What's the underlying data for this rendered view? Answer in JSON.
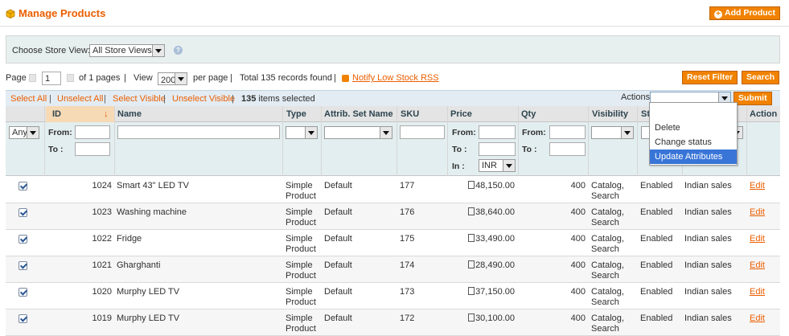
{
  "header": {
    "title": "Manage Products",
    "add_button": "Add Product"
  },
  "store_view": {
    "label": "Choose Store View:",
    "value": "All Store Views"
  },
  "pager": {
    "page_label": "Page",
    "page_value": "1",
    "of_pages": "of 1 pages",
    "view_label": "View",
    "view_value": "200",
    "per_page": "per page",
    "total": "Total 135 records found",
    "rss": "Notify Low Stock RSS",
    "reset_filter": "Reset Filter",
    "search": "Search"
  },
  "massaction": {
    "select_all": "Select All",
    "unselect_all": "Unselect All",
    "select_visible": "Select Visible",
    "unselect_visible": "Unselect Visible",
    "selected_count": "135",
    "selected_label": "items selected",
    "actions_label": "Actions",
    "submit": "Submit",
    "options": [
      "Delete",
      "Change status",
      "Update Attributes"
    ],
    "highlighted": "Update Attributes"
  },
  "columns": {
    "id": "ID",
    "name": "Name",
    "type": "Type",
    "attrib_set": "Attrib. Set Name",
    "sku": "SKU",
    "price": "Price",
    "qty": "Qty",
    "visibility": "Visibility",
    "status": "St",
    "websites": "",
    "action": "Action"
  },
  "filters": {
    "any": "Any",
    "from": "From:",
    "to": "To :",
    "in": "In :",
    "currency": "INR"
  },
  "rows": [
    {
      "id": "1024",
      "name": "Smart 43\" LED TV",
      "type": [
        "Simple",
        "Product"
      ],
      "attrib_set": "Default",
      "sku": "177",
      "price": "48,150.00",
      "qty": "400",
      "visibility": [
        "Catalog,",
        "Search"
      ],
      "status": "Enabled",
      "websites": "Indian sales",
      "action": "Edit"
    },
    {
      "id": "1023",
      "name": "Washing machine",
      "type": [
        "Simple",
        "Product"
      ],
      "attrib_set": "Default",
      "sku": "176",
      "price": "38,640.00",
      "qty": "400",
      "visibility": [
        "Catalog,",
        "Search"
      ],
      "status": "Enabled",
      "websites": "Indian sales",
      "action": "Edit"
    },
    {
      "id": "1022",
      "name": "Fridge",
      "type": [
        "Simple",
        "Product"
      ],
      "attrib_set": "Default",
      "sku": "175",
      "price": "33,490.00",
      "qty": "400",
      "visibility": [
        "Catalog,",
        "Search"
      ],
      "status": "Enabled",
      "websites": "Indian sales",
      "action": "Edit"
    },
    {
      "id": "1021",
      "name": "Gharghanti",
      "type": [
        "Simple",
        "Product"
      ],
      "attrib_set": "Default",
      "sku": "174",
      "price": "28,490.00",
      "qty": "400",
      "visibility": [
        "Catalog,",
        "Search"
      ],
      "status": "Enabled",
      "websites": "Indian sales",
      "action": "Edit"
    },
    {
      "id": "1020",
      "name": "Murphy LED TV",
      "type": [
        "Simple",
        "Product"
      ],
      "attrib_set": "Default",
      "sku": "173",
      "price": "37,150.00",
      "qty": "400",
      "visibility": [
        "Catalog,",
        "Search"
      ],
      "status": "Enabled",
      "websites": "Indian sales",
      "action": "Edit"
    },
    {
      "id": "1019",
      "name": "Murphy LED TV",
      "type": [
        "Simple",
        "Product"
      ],
      "attrib_set": "Default",
      "sku": "172",
      "price": "30,100.00",
      "qty": "400",
      "visibility": [
        "Catalog,",
        "Search"
      ],
      "status": "Enabled",
      "websites": "Indian sales",
      "action": "Edit"
    }
  ],
  "colors": {
    "accent": "#eb5e00",
    "button": "#f18200",
    "filter_bg": "#e3eef0",
    "highlight": "#3875d7"
  }
}
